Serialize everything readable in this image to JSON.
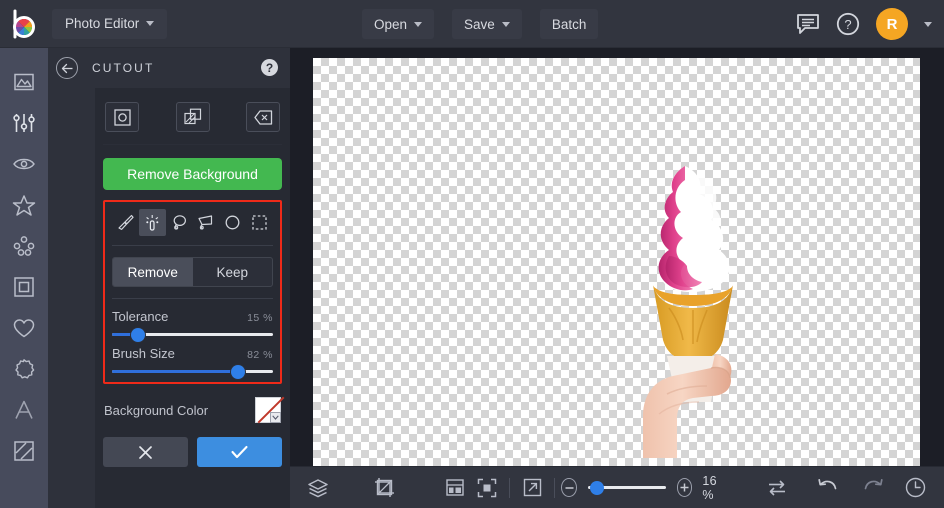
{
  "topbar": {
    "logo_icon": "color-wheel-logo-icon",
    "app_title": "Photo Editor",
    "buttons": [
      {
        "label": "Open",
        "has_caret": true,
        "icon": "chevron-down-icon"
      },
      {
        "label": "Save",
        "has_caret": true,
        "icon": "chevron-down-icon"
      },
      {
        "label": "Batch",
        "has_caret": false,
        "icon": ""
      }
    ],
    "feedback_icon": "comment-icon",
    "help_icon": "question-circle-icon",
    "avatar_initial": "R",
    "avatar_color": "#f5a623",
    "avatar_caret_icon": "chevron-down-icon"
  },
  "rail": {
    "items": [
      {
        "name": "sidebar-item-image",
        "icon": "image-mountain-icon"
      },
      {
        "name": "sidebar-item-adjust",
        "icon": "sliders-icon"
      },
      {
        "name": "sidebar-item-effects",
        "icon": "eye-icon"
      },
      {
        "name": "sidebar-item-overlays",
        "icon": "star-icon"
      },
      {
        "name": "sidebar-item-touchup",
        "icon": "dots-cluster-icon"
      },
      {
        "name": "sidebar-item-frames",
        "icon": "square-frame-icon"
      },
      {
        "name": "sidebar-item-stickers",
        "icon": "heart-icon"
      },
      {
        "name": "sidebar-item-shapes",
        "icon": "badge-icon"
      },
      {
        "name": "sidebar-item-text",
        "icon": "letter-a-icon"
      },
      {
        "name": "sidebar-item-texture",
        "icon": "diagonal-lines-icon"
      }
    ]
  },
  "panel": {
    "back_icon": "arrow-left-icon",
    "title": "CUTOUT",
    "help_icon": "question-circle-icon",
    "modes": [
      {
        "name": "mode-cutout",
        "icon": "square-circle-icon"
      },
      {
        "name": "mode-duplicate",
        "icon": "overlap-shapes-icon"
      },
      {
        "name": "mode-erase",
        "icon": "eraser-icon"
      }
    ],
    "remove_background_label": "Remove Background",
    "remove_background_color": "#43b850",
    "highlight_box_color": "#ef2a19",
    "tools": [
      {
        "name": "tool-brush",
        "icon": "paintbrush-icon",
        "active": false
      },
      {
        "name": "tool-magic-wand",
        "icon": "magic-wand-icon",
        "active": true
      },
      {
        "name": "tool-lasso",
        "icon": "lasso-icon",
        "active": false
      },
      {
        "name": "tool-polygon-lasso",
        "icon": "polygon-lasso-icon",
        "active": false
      },
      {
        "name": "tool-ellipse",
        "icon": "ellipse-icon",
        "active": false
      },
      {
        "name": "tool-rect-marquee",
        "icon": "rect-marquee-icon",
        "active": false
      }
    ],
    "segment": {
      "remove_label": "Remove",
      "keep_label": "Keep",
      "selected": "Remove"
    },
    "sliders": [
      {
        "name": "tolerance",
        "label": "Tolerance",
        "value_text": "15 %",
        "percent": 15
      },
      {
        "name": "brush-size",
        "label": "Brush Size",
        "value_text": "82 %",
        "percent": 82
      }
    ],
    "background_color": {
      "label": "Background Color",
      "swatch_icon": "transparent-none-swatch-icon",
      "dropdown_icon": "chevron-down-icon"
    },
    "actions": {
      "cancel_icon": "close-x-icon",
      "apply_icon": "check-icon",
      "apply_color": "#3d8ee0"
    }
  },
  "canvas": {
    "content_alt": "ice-cream-cone-held-in-hand",
    "background": "transparent-checkerboard"
  },
  "bottombar": {
    "left_icons": [
      {
        "name": "layers-button",
        "icon": "layers-icon"
      },
      {
        "name": "crop-button",
        "icon": "crop-icon"
      },
      {
        "name": "panel-layout-button",
        "icon": "panel-layout-icon"
      },
      {
        "name": "fit-screen-button",
        "icon": "fit-screen-icon"
      },
      {
        "name": "expand-button",
        "icon": "expand-arrow-icon"
      }
    ],
    "zoom_out_icon": "minus-icon",
    "zoom_in_icon": "plus-icon",
    "zoom_value": "16 %",
    "zoom_percent": 16,
    "right_icons": [
      {
        "name": "compare-button",
        "icon": "swap-arrows-icon"
      },
      {
        "name": "undo-button",
        "icon": "undo-arrow-icon"
      },
      {
        "name": "redo-button",
        "icon": "redo-arrow-icon"
      },
      {
        "name": "history-button",
        "icon": "clock-history-icon"
      }
    ]
  }
}
